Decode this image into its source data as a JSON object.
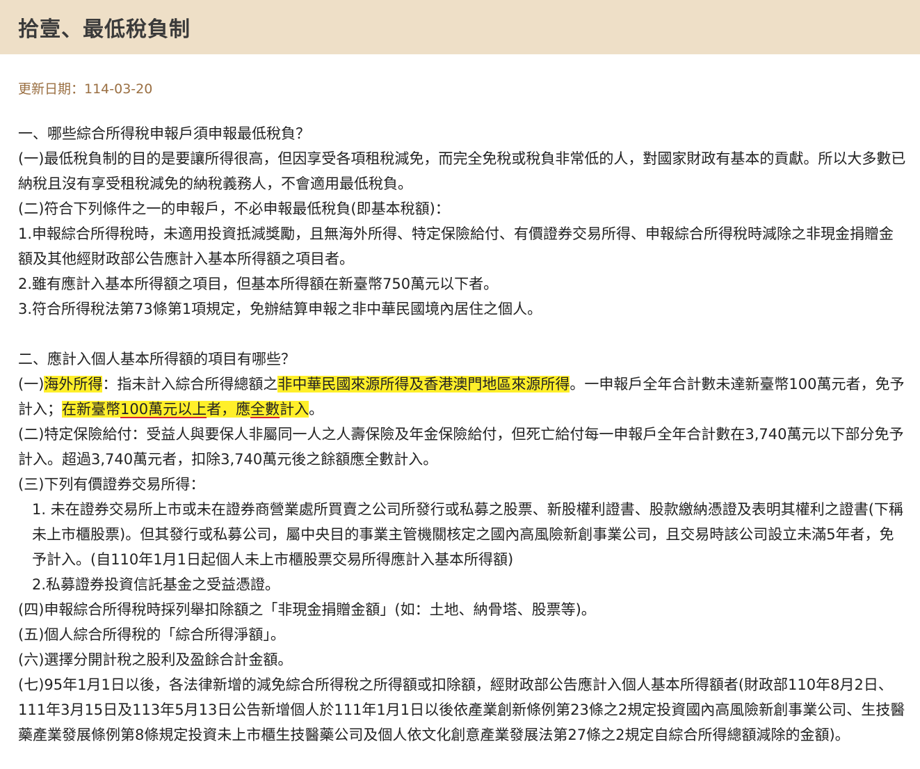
{
  "page_title": "拾壹、最低稅負制",
  "updated": "更新日期：114-03-20",
  "s1_title": "一、哪些綜合所得稅申報戶須申報最低稅負？",
  "s1_p1": "(一)最低稅負制的目的是要讓所得很高，但因享受各項租稅減免，而完全免稅或稅負非常低的人，對國家財政有基本的貢獻。所以大多數已納稅且沒有享受租稅減免的納稅義務人，不會適用最低稅負。",
  "s1_p2": "(二)符合下列條件之一的申報戶，不必申報最低稅負(即基本稅額)：",
  "s1_p3": "1.申報綜合所得稅時，未適用投資抵減獎勵，且無海外所得、特定保險給付、有價證券交易所得、申報綜合所得稅時減除之非現金捐贈金額及其他經財政部公告應計入基本所得額之項目者。",
  "s1_p4": "2.雖有應計入基本所得額之項目，但基本所得額在新臺幣750萬元以下者。",
  "s1_p5": "3.符合所得稅法第73條第1項規定，免辦結算申報之非中華民國境內居住之個人。",
  "s2_title": "二、應計入個人基本所得額的項目有哪些？",
  "s2_i1": {
    "prefix": "(一)",
    "hl1": "海外所得",
    "mid1": "：指未計入綜合所得總額之",
    "hl2": "非中華民國來源所得及香港澳門地區來源所得",
    "mid2": "。一申報戶全年合計數未達新臺幣100萬元者，免予計入；",
    "hl3a": "在新臺幣",
    "hl3u1": "100萬元以上",
    "hl3b": "者，應",
    "hl3u2": "全數",
    "hl3c": "計入",
    "end": "。"
  },
  "s2_i2": "(二)特定保險給付：受益人與要保人非屬同一人之人壽保險及年金保險給付，但死亡給付每一申報戶全年合計數在3,740萬元以下部分免予計入。超過3,740萬元者，扣除3,740萬元後之餘額應全數計入。",
  "s2_i3": "(三)下列有價證券交易所得：",
  "s2_i3_1": "1. 未在證券交易所上市或未在證券商營業處所買賣之公司所發行或私募之股票、新股權利證書、股款繳納憑證及表明其權利之證書(下稱未上市櫃股票)。但其發行或私募公司，屬中央目的事業主管機關核定之國內高風險新創事業公司，且交易時該公司設立未滿5年者，免予計入。(自110年1月1日起個人未上市櫃股票交易所得應計入基本所得額)",
  "s2_i3_2": "2.私募證券投資信託基金之受益憑證。",
  "s2_i4": "(四)申報綜合所得稅時採列舉扣除額之「非現金捐贈金額」(如：土地、納骨塔、股票等)。",
  "s2_i5": "(五)個人綜合所得稅的「綜合所得淨額」。",
  "s2_i6": "(六)選擇分開計稅之股利及盈餘合計金額。",
  "s2_i7": "(七)95年1月1日以後，各法律新增的減免綜合所得稅之所得額或扣除額，經財政部公告應計入個人基本所得額者(財政部110年8月2日、111年3月15日及113年5月13日公告新增個人於111年1月1日以後依產業創新條例第23條之2規定投資國內高風險新創事業公司、生技醫藥產業發展條例第8條規定投資未上市櫃生技醫藥公司及個人依文化創意產業發展法第27條之2規定自綜合所得總額減除的金額)。",
  "colors": {
    "header_bg": "#eedfc7",
    "highlight": "#ffef2a",
    "underline": "#d7262c",
    "date": "#9a6f42"
  }
}
